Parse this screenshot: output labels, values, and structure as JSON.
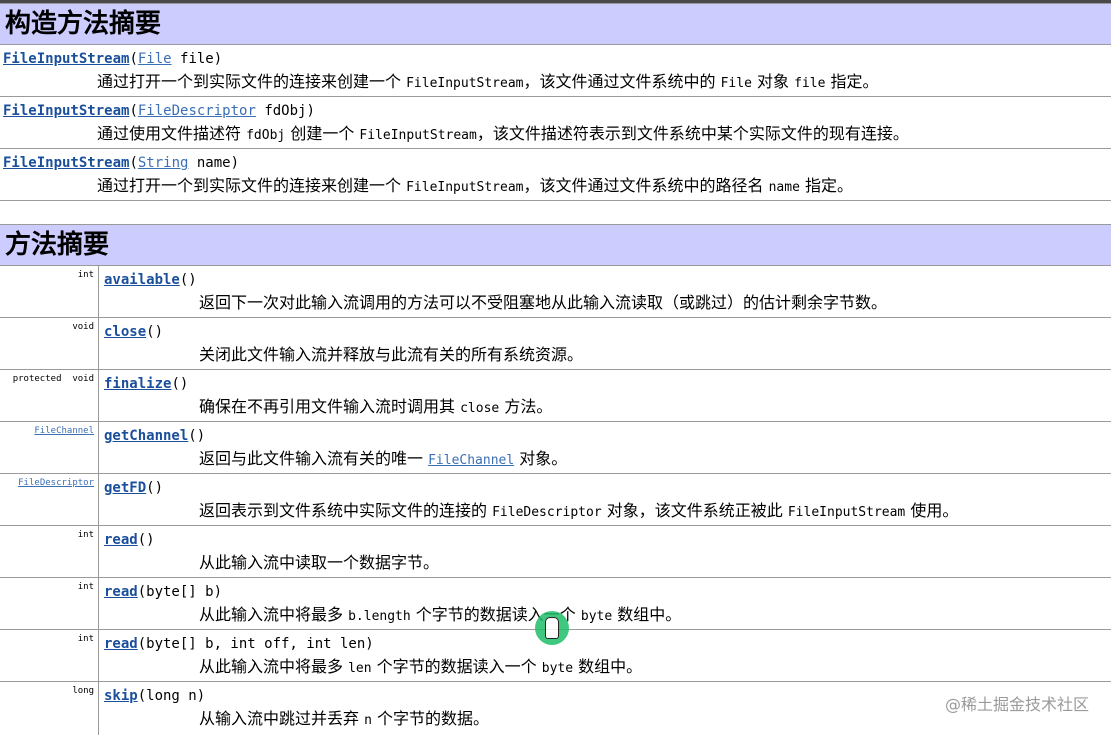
{
  "constructor_summary": {
    "title": "构造方法摘要",
    "rows": [
      {
        "name": "FileInputStream",
        "open": "(",
        "param_type": "File",
        "param_rest": " file)",
        "desc_1": "通过打开一个到实际文件的连接来创建一个 ",
        "code_1": "FileInputStream",
        "desc_2": "，该文件通过文件系统中的 ",
        "code_2": "File",
        "desc_3": " 对象 ",
        "code_3": "file",
        "desc_4": " 指定。"
      },
      {
        "name": "FileInputStream",
        "open": "(",
        "param_type": "FileDescriptor",
        "param_rest": " fdObj)",
        "desc_1": "通过使用文件描述符 ",
        "code_1": "fdObj",
        "desc_2": " 创建一个 ",
        "code_2": "FileInputStream",
        "desc_3": "，该文件描述符表示到文件系统中某个实际文件的现有连接。"
      },
      {
        "name": "FileInputStream",
        "open": "(",
        "param_type": "String",
        "param_rest": " name)",
        "desc_1": "通过打开一个到实际文件的连接来创建一个 ",
        "code_1": "FileInputStream",
        "desc_2": "，该文件通过文件系统中的路径名 ",
        "code_2": "name",
        "desc_3": " 指定。"
      }
    ]
  },
  "method_summary": {
    "title": "方法摘要",
    "rows": [
      {
        "type": "int",
        "type_is_link": false,
        "name": "available",
        "params": "()",
        "desc": "返回下一次对此输入流调用的方法可以不受阻塞地从此输入流读取（或跳过）的估计剩余字节数。"
      },
      {
        "type": "void",
        "type_is_link": false,
        "name": "close",
        "params": "()",
        "desc": "关闭此文件输入流并释放与此流有关的所有系统资源。"
      },
      {
        "type": "protected  void",
        "type_is_link": false,
        "name": "finalize",
        "params": "()",
        "desc_1": "确保在不再引用文件输入流时调用其 ",
        "code_1": "close",
        "desc_2": " 方法。"
      },
      {
        "type": "FileChannel",
        "type_is_link": true,
        "name": "getChannel",
        "params": "()",
        "desc_1": "返回与此文件输入流有关的唯一 ",
        "link_1": "FileChannel",
        "desc_2": " 对象。"
      },
      {
        "type": "FileDescriptor",
        "type_is_link": true,
        "name": "getFD",
        "params": "()",
        "desc_1": "返回表示到文件系统中实际文件的连接的 ",
        "code_1": "FileDescriptor",
        "desc_2": " 对象，该文件系统正被此 ",
        "code_2": "FileInputStream",
        "desc_3": " 使用。"
      },
      {
        "type": "int",
        "type_is_link": false,
        "name": "read",
        "params": "()",
        "desc": "从此输入流中读取一个数据字节。"
      },
      {
        "type": "int",
        "type_is_link": false,
        "name": "read",
        "params": "(byte[] b)",
        "desc_1": "从此输入流中将最多 ",
        "code_1": "b.length",
        "desc_2": " 个字节的数据读入一个 ",
        "code_2": "byte",
        "desc_3": " 数组中。"
      },
      {
        "type": "int",
        "type_is_link": false,
        "name": "read",
        "params": "(byte[] b, int off, int len)",
        "desc_1": "从此输入流中将最多 ",
        "code_1": "len",
        "desc_2": " 个字节的数据读入一个 ",
        "code_2": "byte",
        "desc_3": " 数组中。"
      },
      {
        "type": "long",
        "type_is_link": false,
        "name": "skip",
        "params": "(long n)",
        "desc_1": "从输入流中跳过并丢弃 ",
        "code_1": "n",
        "desc_2": " 个字节的数据。"
      }
    ]
  },
  "watermark": "@稀土掘金技术社区",
  "colors": {
    "header_bg": "#ccccff",
    "link": "#1a4f9c",
    "cursor": "#1fbf6a"
  }
}
